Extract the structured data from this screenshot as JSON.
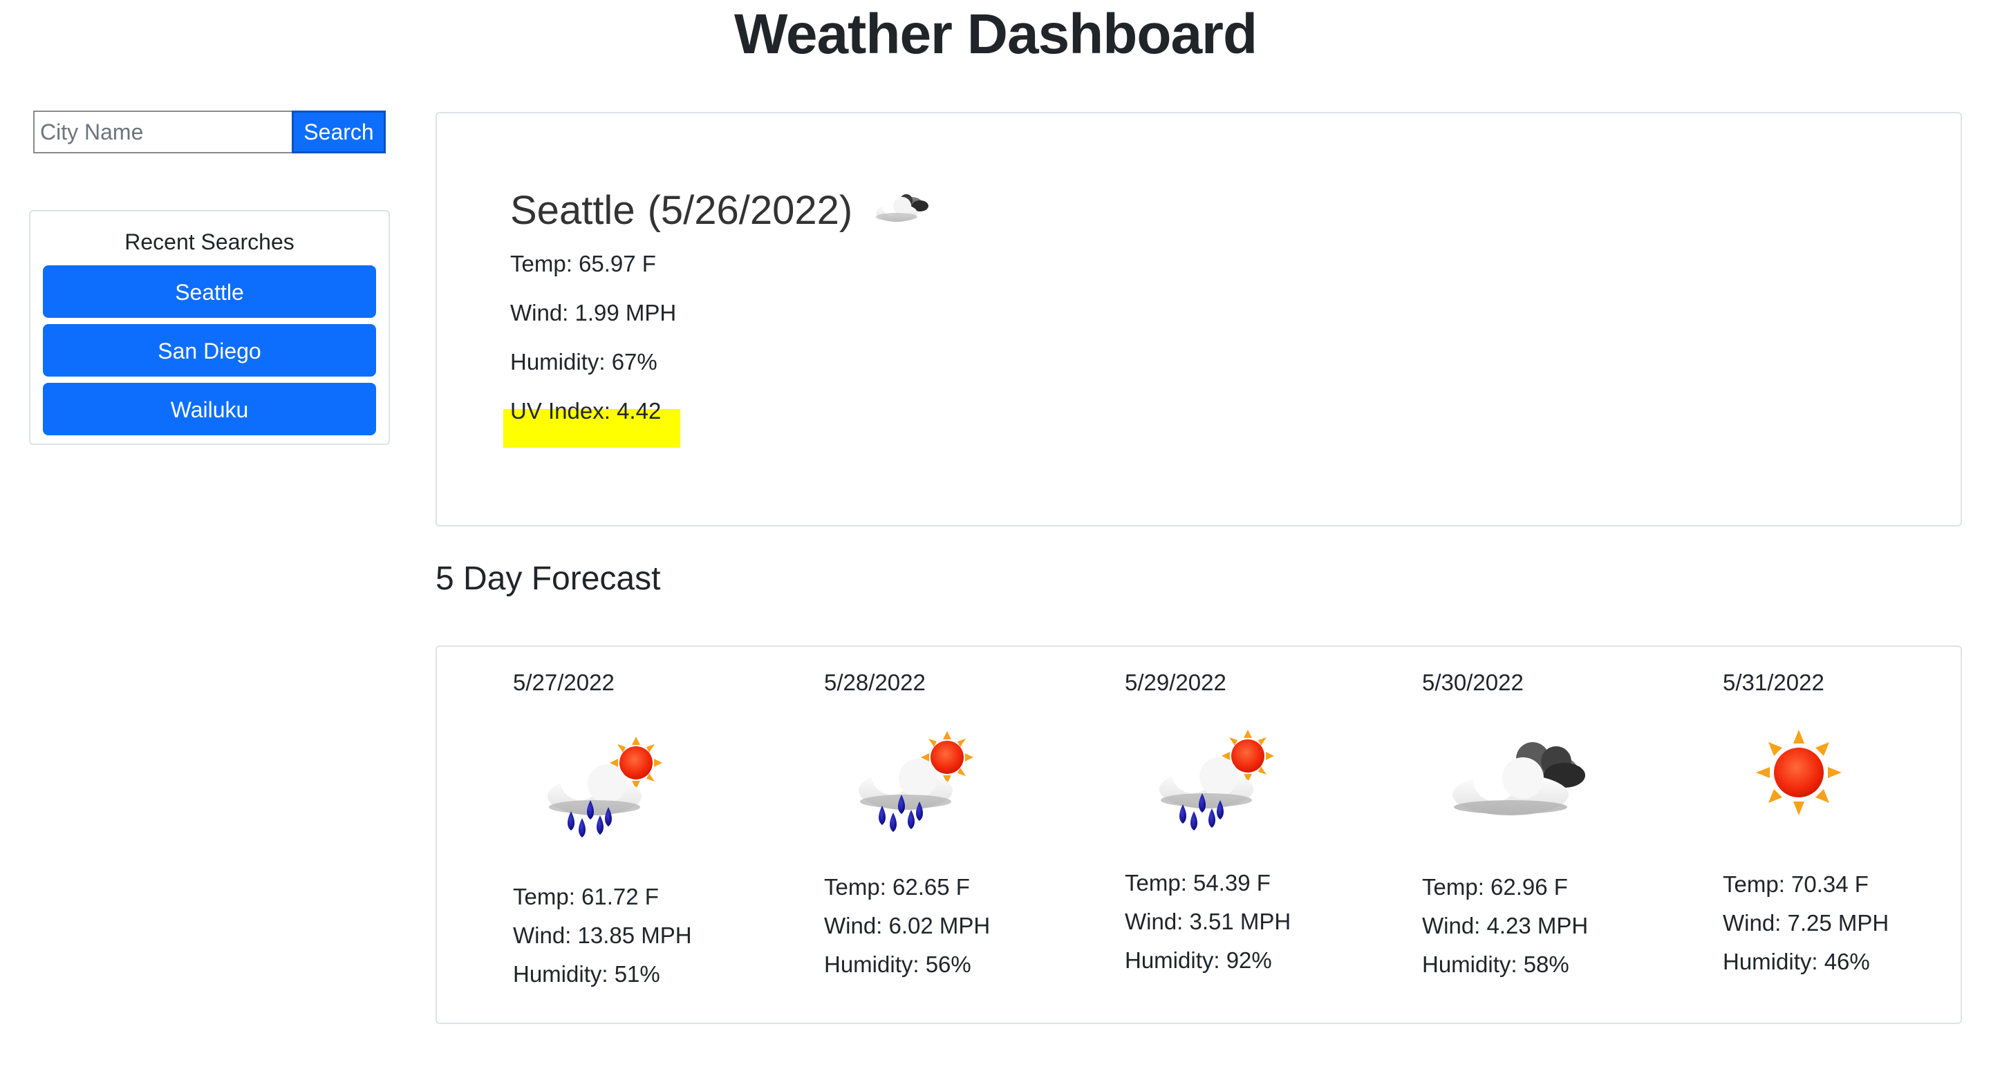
{
  "header": {
    "title": "Weather Dashboard"
  },
  "search": {
    "placeholder": "City Name",
    "value": "",
    "button_label": "Search"
  },
  "recent": {
    "title": "Recent Searches",
    "items": [
      {
        "label": "Seattle"
      },
      {
        "label": "San Diego"
      },
      {
        "label": "Wailuku"
      }
    ]
  },
  "current": {
    "city": "Seattle",
    "date": "(5/26/2022)",
    "icon": "partly-cloudy-night-icon",
    "temp": "Temp: 65.97 F",
    "wind": "Wind: 1.99 MPH",
    "humidity": "Humidity: 67%",
    "uv": "UV Index: 4.42",
    "uv_color": "#ffff00"
  },
  "forecast": {
    "heading": "5 Day Forecast",
    "days": [
      {
        "date": "5/27/2022",
        "icon": "rain-sun-icon",
        "temp": "Temp: 61.72 F",
        "wind": "Wind: 13.85 MPH",
        "humidity": "Humidity: 51%"
      },
      {
        "date": "5/28/2022",
        "icon": "rain-sun-icon",
        "temp": "Temp: 62.65 F",
        "wind": "Wind: 6.02 MPH",
        "humidity": "Humidity: 56%"
      },
      {
        "date": "5/29/2022",
        "icon": "rain-sun-icon",
        "temp": "Temp: 54.39 F",
        "wind": "Wind: 3.51 MPH",
        "humidity": "Humidity: 92%"
      },
      {
        "date": "5/30/2022",
        "icon": "broken-clouds-icon",
        "temp": "Temp: 62.96 F",
        "wind": "Wind: 4.23 MPH",
        "humidity": "Humidity: 58%"
      },
      {
        "date": "5/31/2022",
        "icon": "clear-sun-icon",
        "temp": "Temp: 70.34 F",
        "wind": "Wind: 7.25 MPH",
        "humidity": "Humidity: 46%"
      }
    ]
  },
  "colors": {
    "primary": "#0d6efd",
    "uv_highlight": "#ffff00",
    "text": "#212529"
  }
}
